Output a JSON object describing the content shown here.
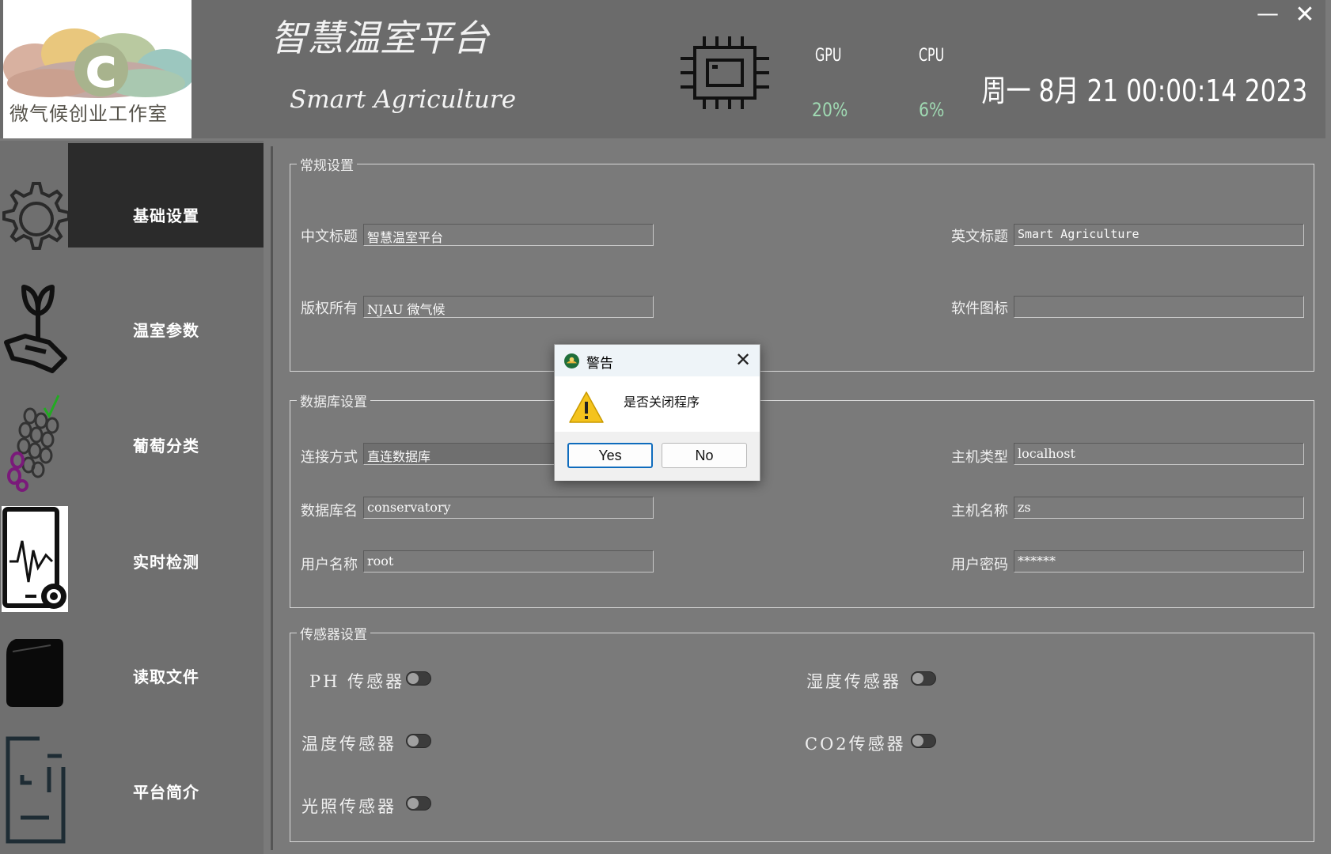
{
  "header": {
    "logo_caption": "微气候创业工作室",
    "logo_letter": "c",
    "title_cn": "智慧温室平台",
    "title_en": "Smart Agriculture",
    "gpu_label": "GPU",
    "gpu_value": "20%",
    "cpu_label": "CPU",
    "cpu_value": "6%",
    "datetime": "周一 8月 21 00:00:14 2023",
    "minimize": "—",
    "close": "✕"
  },
  "sidebar": {
    "items": [
      {
        "label": "基础设置",
        "icon": "gear-icon",
        "active": true
      },
      {
        "label": "温室参数",
        "icon": "plant-hand-icon",
        "active": false
      },
      {
        "label": "葡萄分类",
        "icon": "grape-icon",
        "active": false
      },
      {
        "label": "实时检测",
        "icon": "monitor-icon",
        "active": false
      },
      {
        "label": "读取文件",
        "icon": "file-icon",
        "active": false
      },
      {
        "label": "平台简介",
        "icon": "document-icon",
        "active": false
      }
    ]
  },
  "general": {
    "title": "常规设置",
    "cn_title_label": "中文标题",
    "cn_title_value": "智慧温室平台",
    "en_title_label": "英文标题",
    "en_title_value": "Smart Agriculture",
    "copyright_label": "版权所有",
    "copyright_value": "NJAU 微气候",
    "icon_label": "软件图标",
    "icon_value": ""
  },
  "database": {
    "title": "数据库设置",
    "conn_label": "连接方式",
    "conn_value": "直连数据库",
    "host_type_label": "主机类型",
    "host_type_value": "localhost",
    "db_name_label": "数据库名",
    "db_name_value": "conservatory",
    "host_name_label": "主机名称",
    "host_name_value": "zs",
    "user_label": "用户名称",
    "user_value": "root",
    "pwd_label": "用户密码",
    "pwd_value": "******"
  },
  "sensors": {
    "title": "传感器设置",
    "ph": "PH 传感器",
    "humidity": "湿度传感器",
    "temperature": "温度传感器",
    "co2": "CO2传感器",
    "light": "光照传感器"
  },
  "dialog": {
    "title": "警告",
    "message": "是否关闭程序",
    "yes": "Yes",
    "no": "No",
    "close": "✕"
  },
  "colors": {
    "accent_green": "#9fd9b2",
    "active_nav": "#2b2b2b",
    "dialog_default_border": "#0f6cbd"
  }
}
